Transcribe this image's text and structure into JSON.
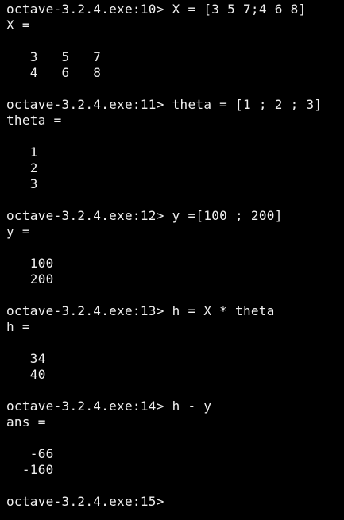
{
  "lines": [
    "octave-3.2.4.exe:10> X = [3 5 7;4 6 8]",
    "X =",
    "",
    "   3   5   7",
    "   4   6   8",
    "",
    "octave-3.2.4.exe:11> theta = [1 ; 2 ; 3]",
    "theta =",
    "",
    "   1",
    "   2",
    "   3",
    "",
    "octave-3.2.4.exe:12> y =[100 ; 200]",
    "y =",
    "",
    "   100",
    "   200",
    "",
    "octave-3.2.4.exe:13> h = X * theta",
    "h =",
    "",
    "   34",
    "   40",
    "",
    "octave-3.2.4.exe:14> h - y",
    "ans =",
    "",
    "   -66",
    "  -160",
    "",
    "octave-3.2.4.exe:15>"
  ]
}
